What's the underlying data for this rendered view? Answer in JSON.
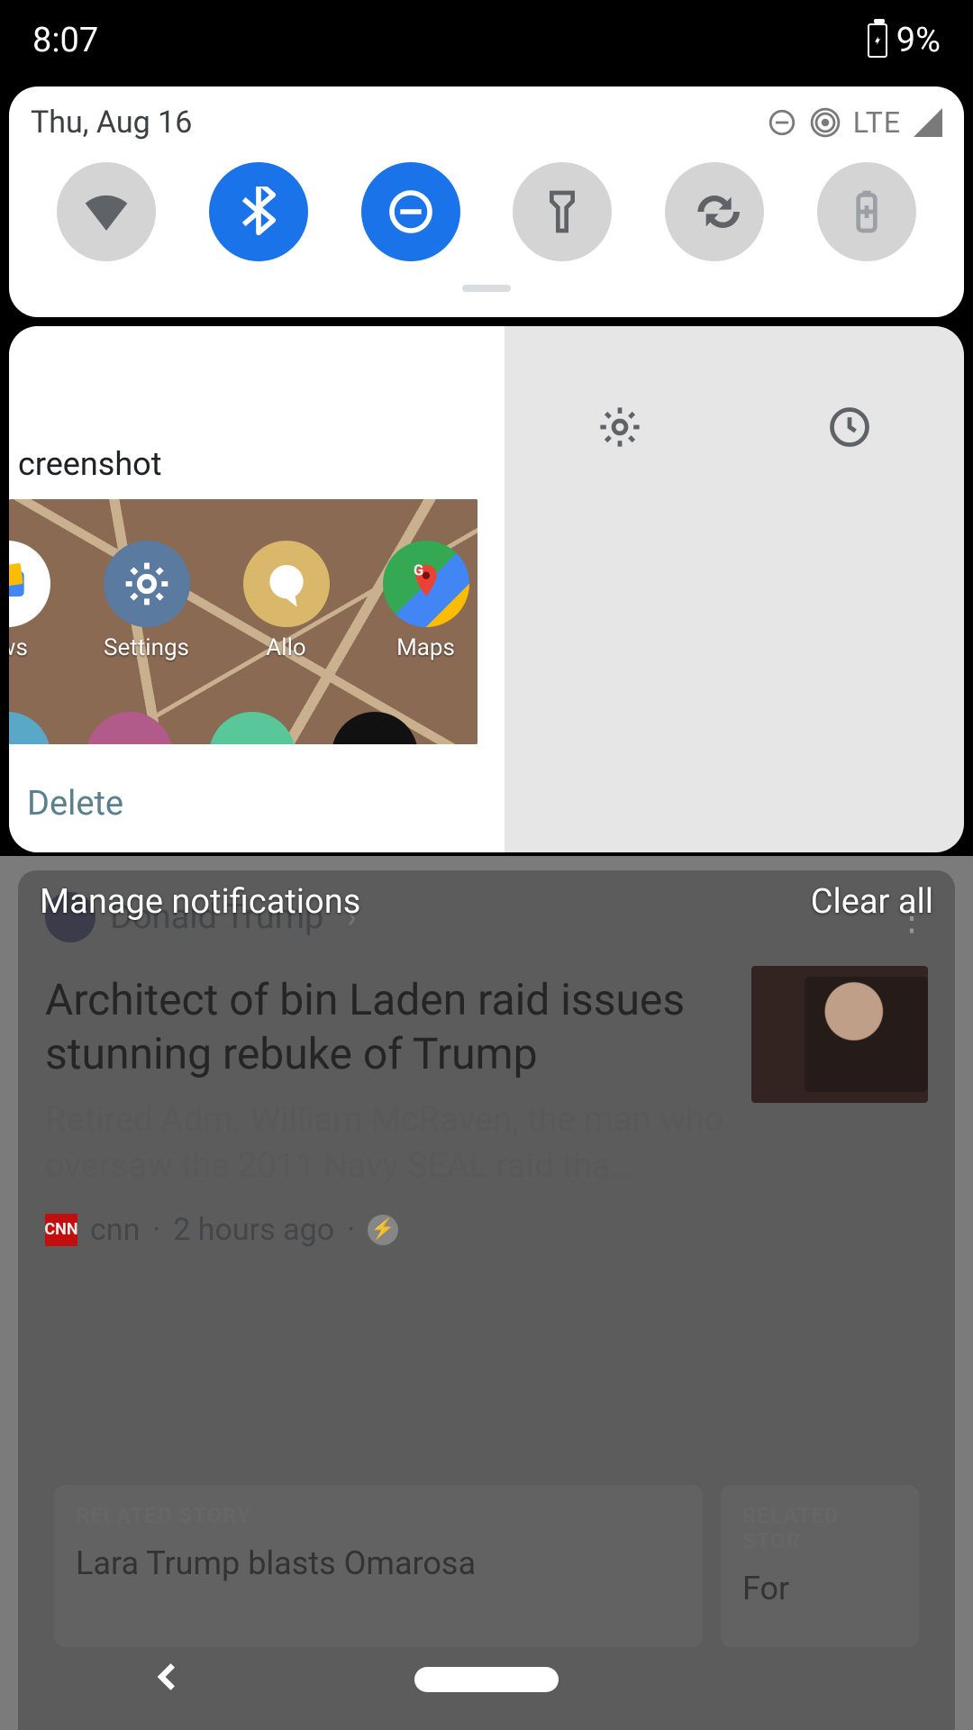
{
  "status": {
    "time": "8:07",
    "battery_pct": "9%"
  },
  "qs": {
    "date": "Thu, Aug 16",
    "network": "LTE",
    "tiles": [
      {
        "name": "wifi",
        "on": false
      },
      {
        "name": "bluetooth",
        "on": true
      },
      {
        "name": "dnd",
        "on": true
      },
      {
        "name": "flashlight",
        "on": false
      },
      {
        "name": "autorotate",
        "on": false
      },
      {
        "name": "battery-saver",
        "on": false
      }
    ]
  },
  "screenshot_notif": {
    "title": "creenshot",
    "delete_label": "Delete",
    "apps": [
      {
        "label": "ews",
        "color": "#ffffff"
      },
      {
        "label": "Settings",
        "color": "#5a7aa0"
      },
      {
        "label": "Allo",
        "color": "#d9b86b"
      },
      {
        "label": "Maps",
        "color": "#4caf50"
      }
    ]
  },
  "manage": {
    "manage_label": "Manage notifications",
    "clear_label": "Clear all"
  },
  "news": {
    "source_name": "Donald Trump",
    "headline": "Architect of bin Laden raid issues stunning rebuke of Trump",
    "subhead": "Retired Adm. William McRaven, the man who oversaw the 2011 Navy SEAL raid tha…",
    "outlet": "cnn",
    "age": "2 hours ago"
  },
  "related": {
    "tag": "RELATED STORY",
    "left_title": "Lara Trump blasts Omarosa",
    "right_tag": "RELATED STOR",
    "right_title": "For"
  }
}
